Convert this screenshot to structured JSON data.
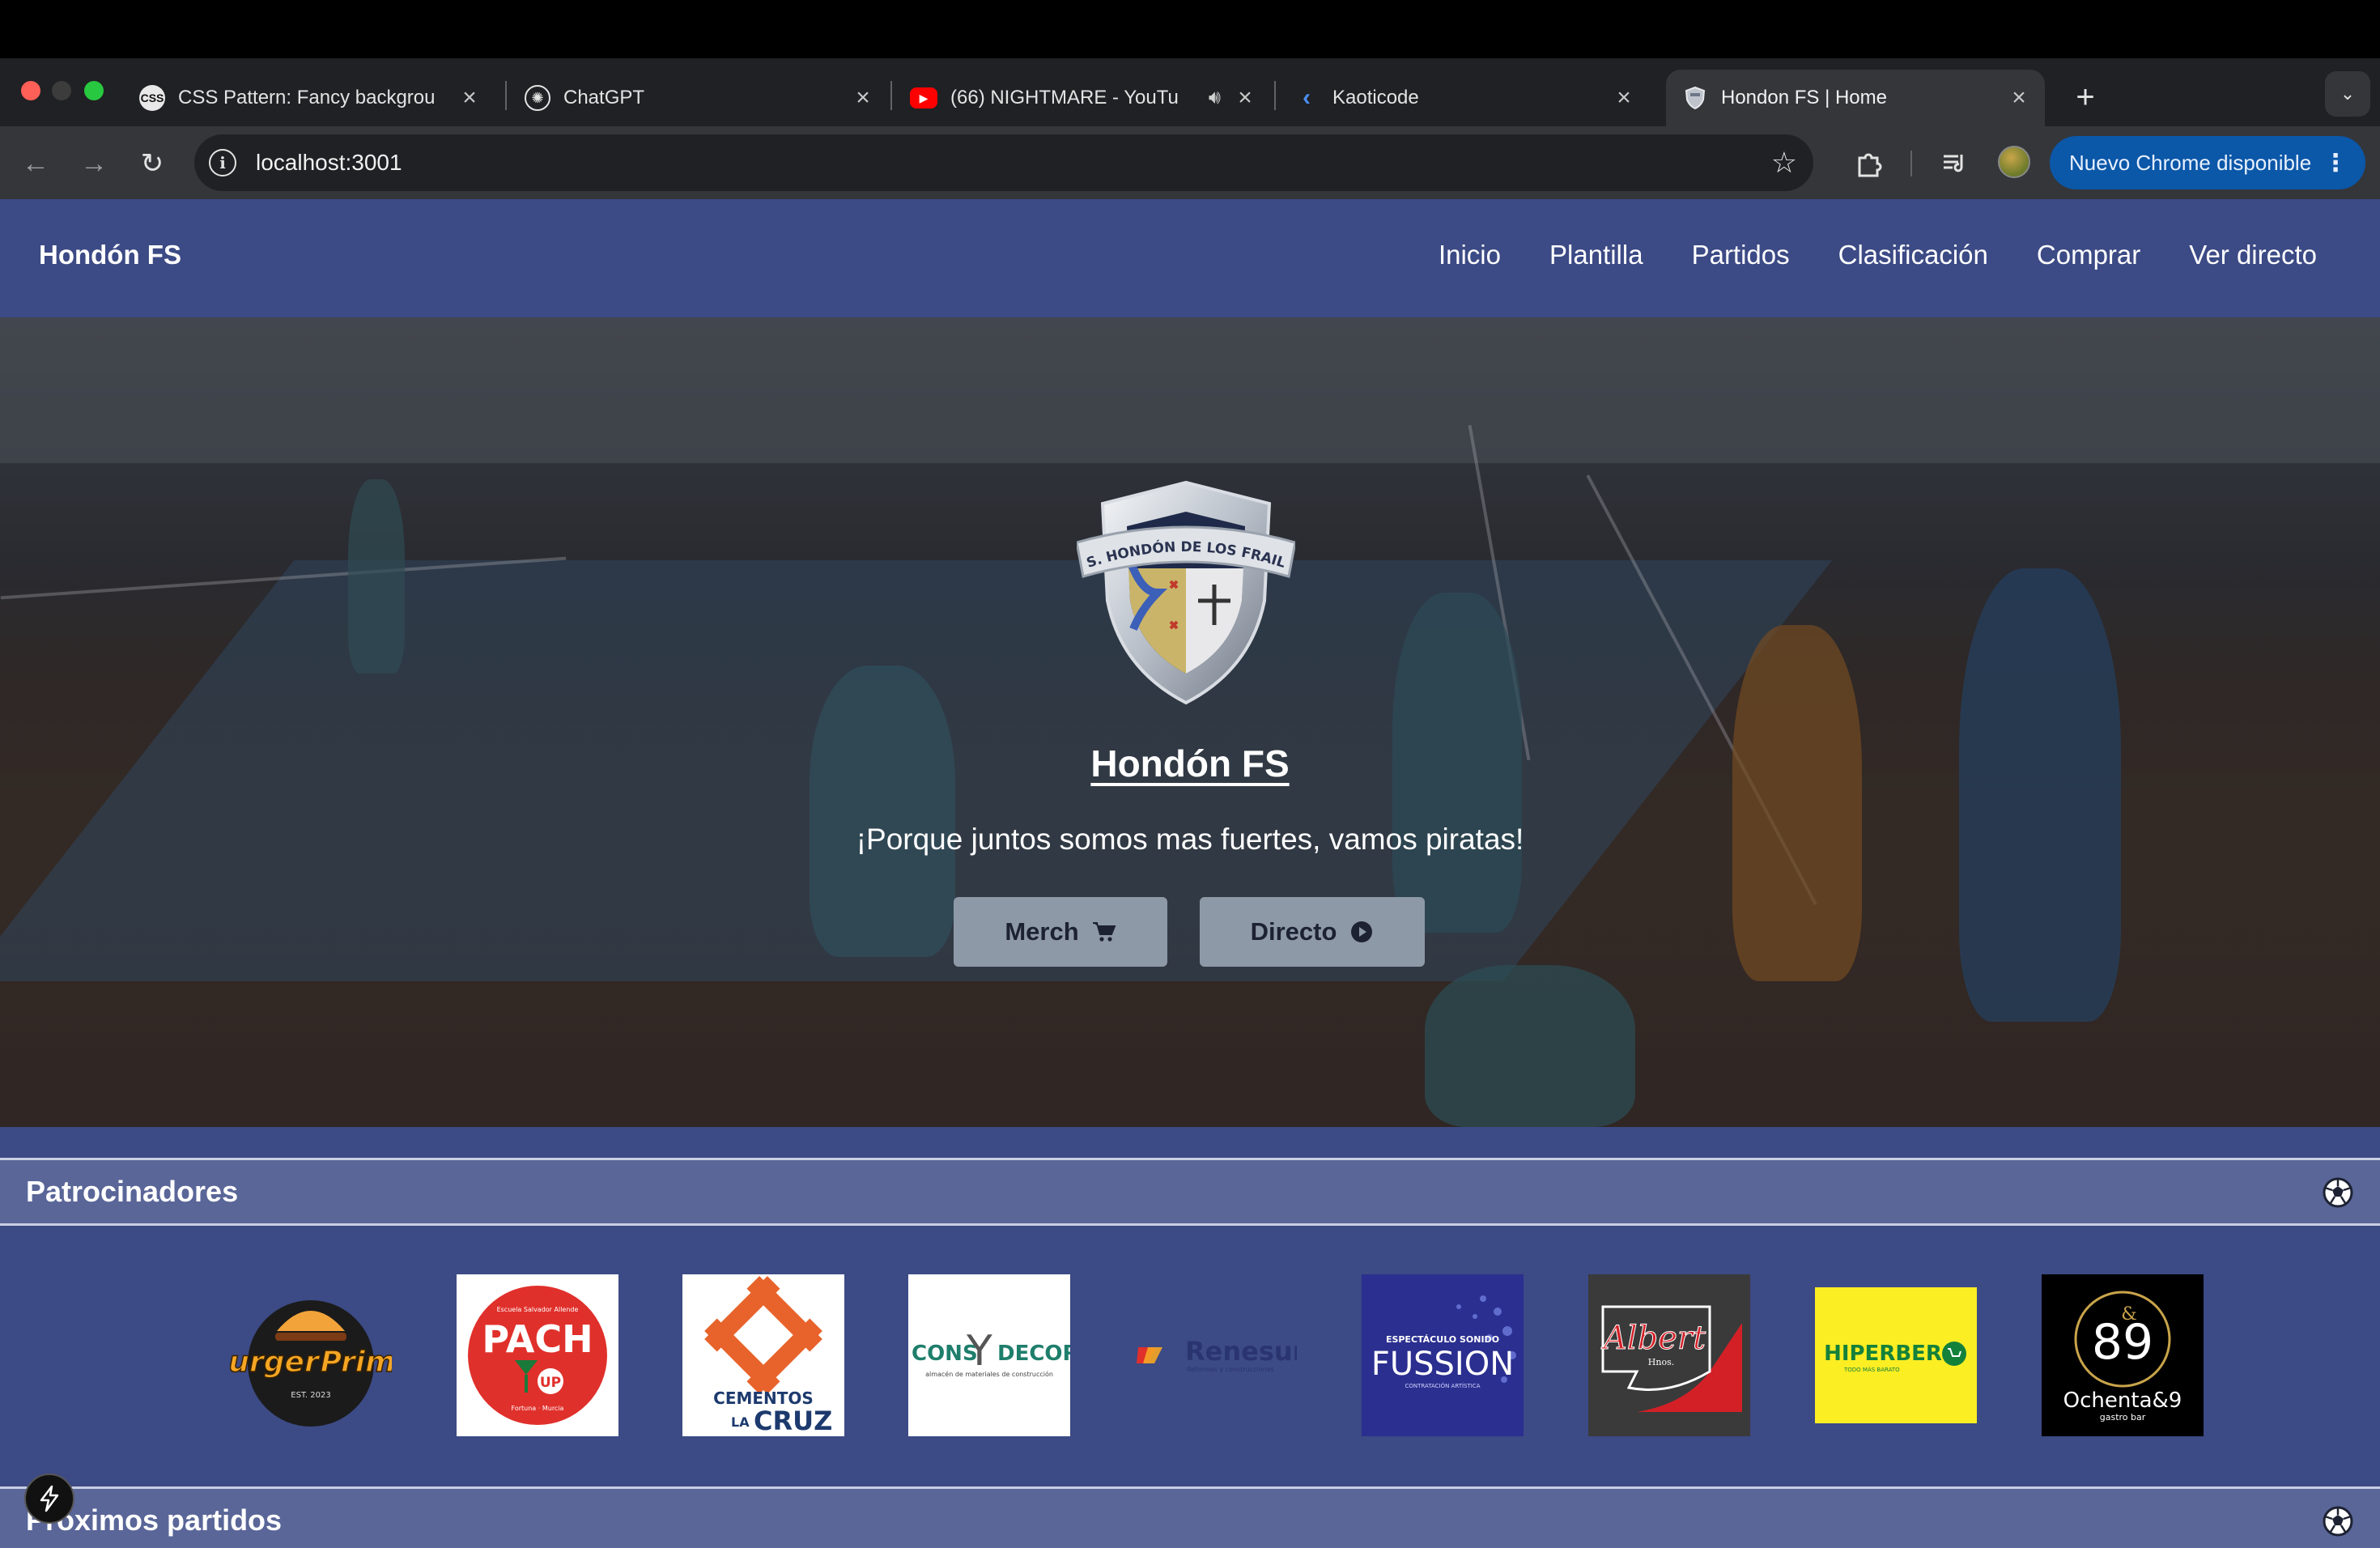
{
  "browser": {
    "tabs": [
      {
        "title": "CSS Pattern: Fancy backgrou",
        "favicon": "css-pattern-icon"
      },
      {
        "title": "ChatGPT",
        "favicon": "chatgpt-icon"
      },
      {
        "title": "(66) NIGHTMARE - YouTu",
        "favicon": "youtube-icon"
      },
      {
        "title": "Kaoticode",
        "favicon": "kaoticode-icon"
      },
      {
        "title": "Hondon FS | Home",
        "favicon": "shield-icon",
        "active": true
      }
    ],
    "url": "localhost:3001",
    "update_button": "Nuevo Chrome disponible"
  },
  "site": {
    "brand": "Hondón FS",
    "nav": [
      "Inicio",
      "Plantilla",
      "Partidos",
      "Clasificación",
      "Comprar",
      "Ver directo"
    ]
  },
  "hero": {
    "crest_text": "CFS. HONDÓN DE LOS FRAILES",
    "title": "Hondón FS",
    "subtitle": "¡Porque juntos somos mas fuertes, vamos piratas!",
    "buttons": [
      {
        "label": "Merch",
        "icon": "cart-icon"
      },
      {
        "label": "Directo",
        "icon": "play-circle-icon"
      }
    ]
  },
  "sponsors_section": {
    "title": "Patrocinadores",
    "logos": [
      {
        "line1": "Burger",
        "line2": "Prime",
        "small": "EST. 2023"
      },
      {
        "top": "Escuela Salvador Allende",
        "main": "PACH",
        "sub": "UP",
        "bottom": "Fortuna · Murcia"
      },
      {
        "line1": "CEMENTOS",
        "line2a": "LA",
        "line2b": "CRUZ"
      },
      {
        "left": "CONS",
        "mid": "Y",
        "right": "DECOR",
        "small": "almacén de materiales de construcción"
      },
      {
        "name": "Renesur",
        "small": "Reformas y construcciones"
      },
      {
        "top": "ESPECTÁCULO SONIDO",
        "main": "FUSSION",
        "small": "CONTRATACIÓN ARTÍSTICA"
      },
      {
        "main": "Albert",
        "sub": "Hnos."
      },
      {
        "main": "HIPERBER",
        "small": "TODO MÁS BARATO"
      },
      {
        "main": "89",
        "amp": "&",
        "name": "Ochenta&9",
        "small": "gastro bar"
      }
    ]
  },
  "matches_section": {
    "title": "Próximos partidos"
  },
  "colors": {
    "nav_bg": "#3c4a85",
    "section_bar": "#5a6698",
    "button_bg": "#8e99a8",
    "chrome_update": "#0b57a8"
  }
}
